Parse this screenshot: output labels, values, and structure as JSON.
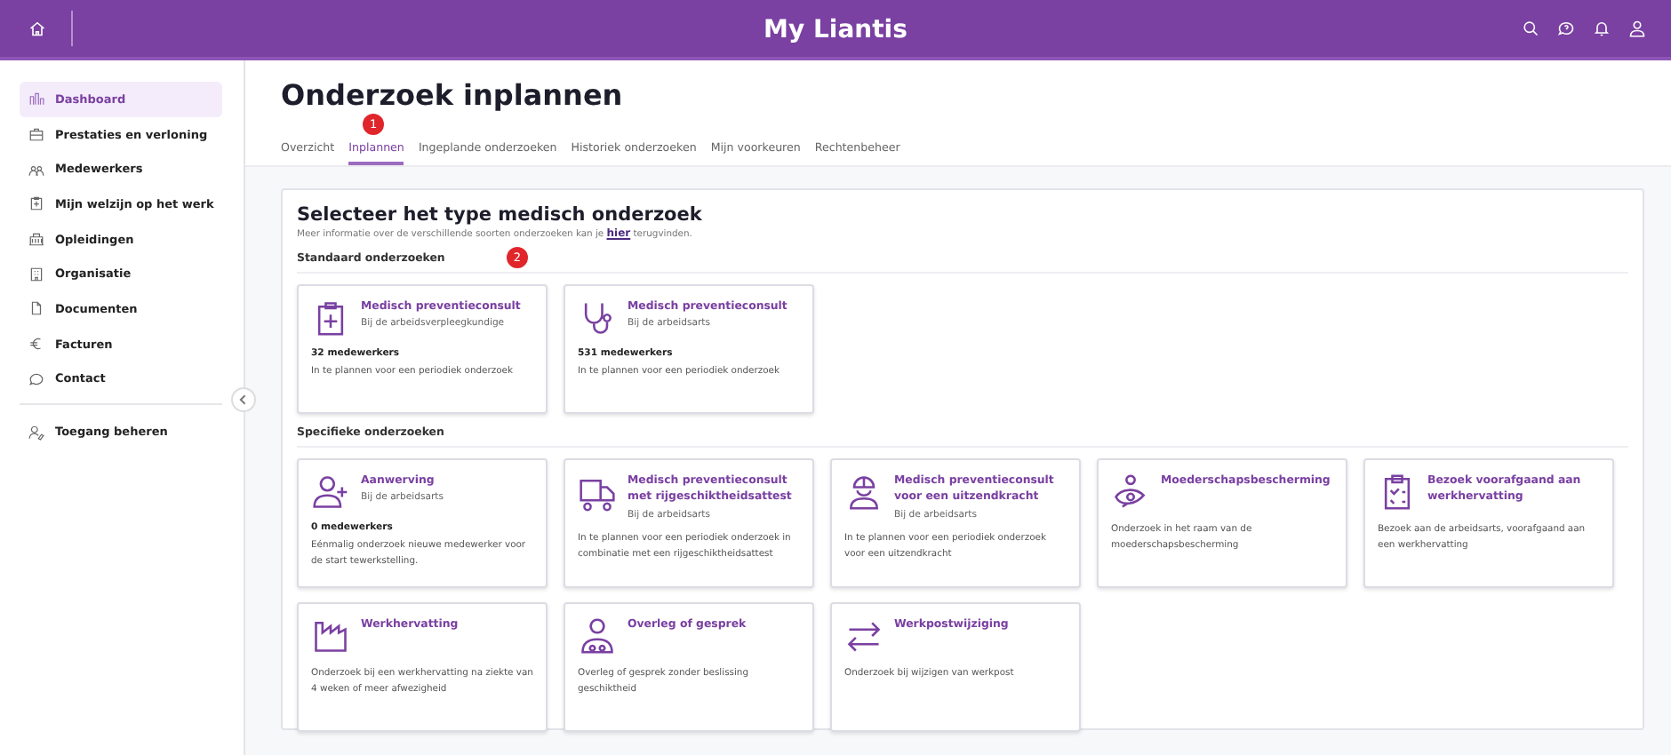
{
  "header": {
    "title": "My Liantis"
  },
  "sidebar": {
    "items": [
      {
        "label": "Dashboard",
        "selected": true
      },
      {
        "label": "Prestaties en verloning",
        "selected": false
      },
      {
        "label": "Medewerkers",
        "selected": false
      },
      {
        "label": "Mijn welzijn op het werk",
        "selected": false
      },
      {
        "label": "Opleidingen",
        "selected": false
      },
      {
        "label": "Organisatie",
        "selected": false
      },
      {
        "label": "Documenten",
        "selected": false
      },
      {
        "label": "Facturen",
        "selected": false
      },
      {
        "label": "Contact",
        "selected": false
      }
    ],
    "footer_item": {
      "label": "Toegang beheren"
    }
  },
  "page": {
    "title": "Onderzoek inplannen"
  },
  "tabs": [
    {
      "label": "Overzicht",
      "selected": false
    },
    {
      "label": "Inplannen",
      "selected": true,
      "badge": "1"
    },
    {
      "label": "Ingeplande onderzoeken",
      "selected": false
    },
    {
      "label": "Historiek onderzoeken",
      "selected": false
    },
    {
      "label": "Mijn voorkeuren",
      "selected": false
    },
    {
      "label": "Rechtenbeheer",
      "selected": false
    }
  ],
  "panel": {
    "title": "Selecteer het type medisch onderzoek",
    "intro": "Meer informatie over de verschillende soorten onderzoeken kan je",
    "link": "hier",
    "intro_end": "terugvinden.",
    "sections": [
      {
        "title": "Standaard onderzoeken",
        "badge": "2",
        "cards": [
          {
            "title": "Medisch preventieconsult",
            "subtitle": "Bij de arbeidsverpleegkundige",
            "count": "32 medewerkers",
            "description": "In te plannen voor een periodiek onderzoek"
          },
          {
            "title": "Medisch preventieconsult",
            "subtitle": "Bij de arbeidsarts",
            "count": "531 medewerkers",
            "description": "In te plannen voor een periodiek onderzoek"
          }
        ]
      },
      {
        "title": "Specifieke onderzoeken",
        "cards": [
          {
            "title": "Aanwerving",
            "subtitle": "Bij de arbeidsarts",
            "count": "0 medewerkers",
            "description": "Eénmalig onderzoek nieuwe medewerker voor de start tewerkstelling."
          },
          {
            "title": "Medisch preventieconsult met rijgeschiktheidsattest",
            "subtitle": "Bij de arbeidsarts",
            "description": "In te plannen voor een periodiek onderzoek in combinatie met een rijgeschiktheidsattest"
          },
          {
            "title": "Medisch preventieconsult voor een uitzendkracht",
            "subtitle": "Bij de arbeidsarts",
            "description": "In te plannen voor een periodiek onderzoek voor een uitzendkracht"
          },
          {
            "title": "Moederschapsbescherming",
            "description": "Onderzoek in het raam van de moederschapsbescherming"
          },
          {
            "title": "Bezoek voorafgaand aan werkhervatting",
            "description": "Bezoek aan de arbeidsarts, voorafgaand aan een werkhervatting"
          },
          {
            "title": "Werkhervatting",
            "description": "Onderzoek bij een werkhervatting na ziekte van 4 weken of meer afwezigheid"
          },
          {
            "title": "Overleg of gesprek",
            "description": "Overleg of gesprek zonder beslissing geschiktheid"
          },
          {
            "title": "Werkpostwijziging",
            "description": "Onderzoek bij wijzigen van werkpost"
          }
        ]
      }
    ]
  }
}
